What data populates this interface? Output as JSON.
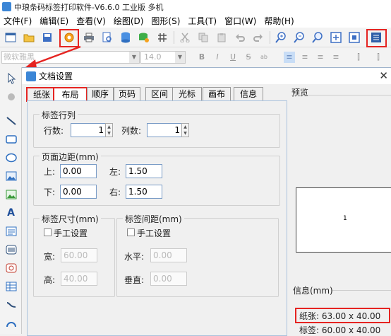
{
  "window": {
    "title": "中琅条码标签打印软件-V6.6.0 工业版 多机"
  },
  "menu": [
    "文件(F)",
    "编辑(E)",
    "查看(V)",
    "绘图(D)",
    "图形(S)",
    "工具(T)",
    "窗口(W)",
    "帮助(H)"
  ],
  "toolbar": {
    "icons": [
      "new-icon",
      "open-icon",
      "save-icon",
      "document-settings-icon",
      "print-icon",
      "print-preview-icon",
      "database-icon",
      "database-settings-icon",
      "grid-icon",
      "cut-icon",
      "copy-icon",
      "paste-icon",
      "undo-icon",
      "redo-icon",
      "zoom-in-icon",
      "zoom-out-icon",
      "zoom-icon",
      "fit-icon",
      "actual-size-icon",
      "settings-icon"
    ]
  },
  "format_bar": {
    "font_value": "微软雅黑",
    "size_value": "14.0",
    "buttons": [
      "B",
      "I",
      "U",
      "S",
      "ab",
      "≡",
      "≡",
      "≡",
      "≡",
      "⫿",
      "⫿"
    ]
  },
  "dialog": {
    "title": "文档设置",
    "tabs": [
      "纸张",
      "布局",
      "顺序",
      "页码",
      "区间",
      "光标",
      "画布",
      "信息"
    ],
    "active_tab": "布局",
    "label_rows_cols": {
      "title": "标签行列",
      "rows_label": "行数:",
      "rows_value": "1",
      "cols_label": "列数:",
      "cols_value": "1"
    },
    "page_margin": {
      "title": "页面边距(mm)",
      "top_label": "上:",
      "top_value": "0.00",
      "left_label": "左:",
      "left_value": "1.50",
      "bottom_label": "下:",
      "bottom_value": "0.00",
      "right_label": "右:",
      "right_value": "1.50"
    },
    "label_size": {
      "title": "标签尺寸(mm)",
      "manual_label": "手工设置",
      "manual_checked": false,
      "width_label": "宽:",
      "width_value": "60.00",
      "height_label": "高:",
      "height_value": "40.00"
    },
    "label_spacing": {
      "title": "标签间距(mm)",
      "manual_label": "手工设置",
      "manual_checked": false,
      "horizontal_label": "水平:",
      "horizontal_value": "0.00",
      "vertical_label": "垂直:",
      "vertical_value": "0.00"
    },
    "preview": {
      "title": "预览",
      "page_number": "1"
    },
    "info": {
      "title": "信息(mm)",
      "paper": "纸张: 63.00 x 40.00",
      "label": "标签: 60.00 x 40.00"
    }
  },
  "colors": {
    "highlight": "#e52421",
    "accent": "#3c86d6"
  }
}
